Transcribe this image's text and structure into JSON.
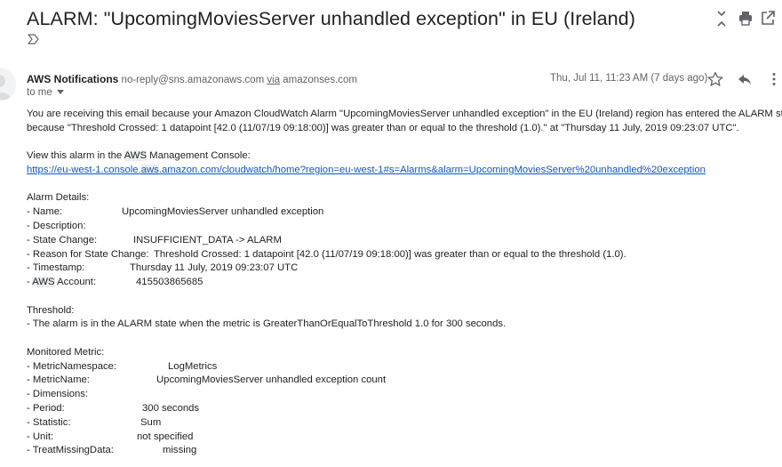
{
  "subject": "ALARM: \"UpcomingMoviesServer unhandled exception\" in EU (Ireland)",
  "icons": {
    "importance": "important-marker-icon",
    "expand": "expand-collapse-icon",
    "print": "print-icon",
    "popout": "open-in-new-window-icon",
    "star": "star-icon",
    "reply": "reply-icon",
    "more": "more-vertical-icon"
  },
  "sender": {
    "name": "AWS Notifications",
    "email": "no-reply@sns.amazonaws.com",
    "via": "via",
    "via_domain": "amazonses.com",
    "to": "to me"
  },
  "date": "Thu, Jul 11, 11:23 AM (7 days ago)",
  "body": {
    "intro_1": "You are receiving this email because your Amazon CloudWatch Alarm \"UpcomingMoviesServer unhandled exception\" in the EU (Ireland) region has entered the ALARM state,",
    "intro_2": "because \"Threshold Crossed: 1 datapoint [42.0 (11/07/19 09:18:00)] was greater than or equal to the threshold (1.0).\" at \"Thursday 11 July, 2019 09:23:07 UTC\".",
    "console_pre": "View this alarm in the ",
    "console_aws": "AWS",
    "console_post": " Management Console:",
    "link_pre": "https://eu-west-1.console.",
    "link_aws": "aws",
    "link_post": ".amazon.com/cloudwatch/home?region=eu-west-1#s=Alarms&alarm=UpcomingMoviesServer%20unhandled%20exception",
    "alarm_details_heading": "Alarm Details:",
    "alarm_details": {
      "name_label": "- Name:",
      "name_value": "UpcomingMoviesServer unhandled exception",
      "description_label": "- Description:",
      "state_label": "- State Change:",
      "state_value": "INSUFFICIENT_DATA -> ALARM",
      "reason_label": "- Reason for State Change:",
      "reason_value": "Threshold Crossed: 1 datapoint [42.0 (11/07/19 09:18:00)] was greater than or equal to the threshold (1.0).",
      "timestamp_label": "- Timestamp:",
      "timestamp_value": "Thursday 11 July, 2019 09:23:07 UTC",
      "account_pre": "- ",
      "account_aws": "AWS",
      "account_post": " Account:",
      "account_value": "415503865685"
    },
    "threshold_heading": "Threshold:",
    "threshold_line": "- The alarm is in the ALARM state when the metric is GreaterThanOrEqualToThreshold 1.0 for 300 seconds.",
    "monitored_heading": "Monitored Metric:",
    "monitored": {
      "namespace_label": "- MetricNamespace:",
      "namespace_value": "LogMetrics",
      "metricname_label": "- MetricName:",
      "metricname_value": "UpcomingMoviesServer unhandled exception count",
      "dimensions_label": "- Dimensions:",
      "period_label": "- Period:",
      "period_value": "300 seconds",
      "statistic_label": "- Statistic:",
      "statistic_value": "Sum",
      "unit_label": "- Unit:",
      "unit_value": "not specified",
      "treat_label": "- TreatMissingData:",
      "treat_value": "missing"
    }
  }
}
